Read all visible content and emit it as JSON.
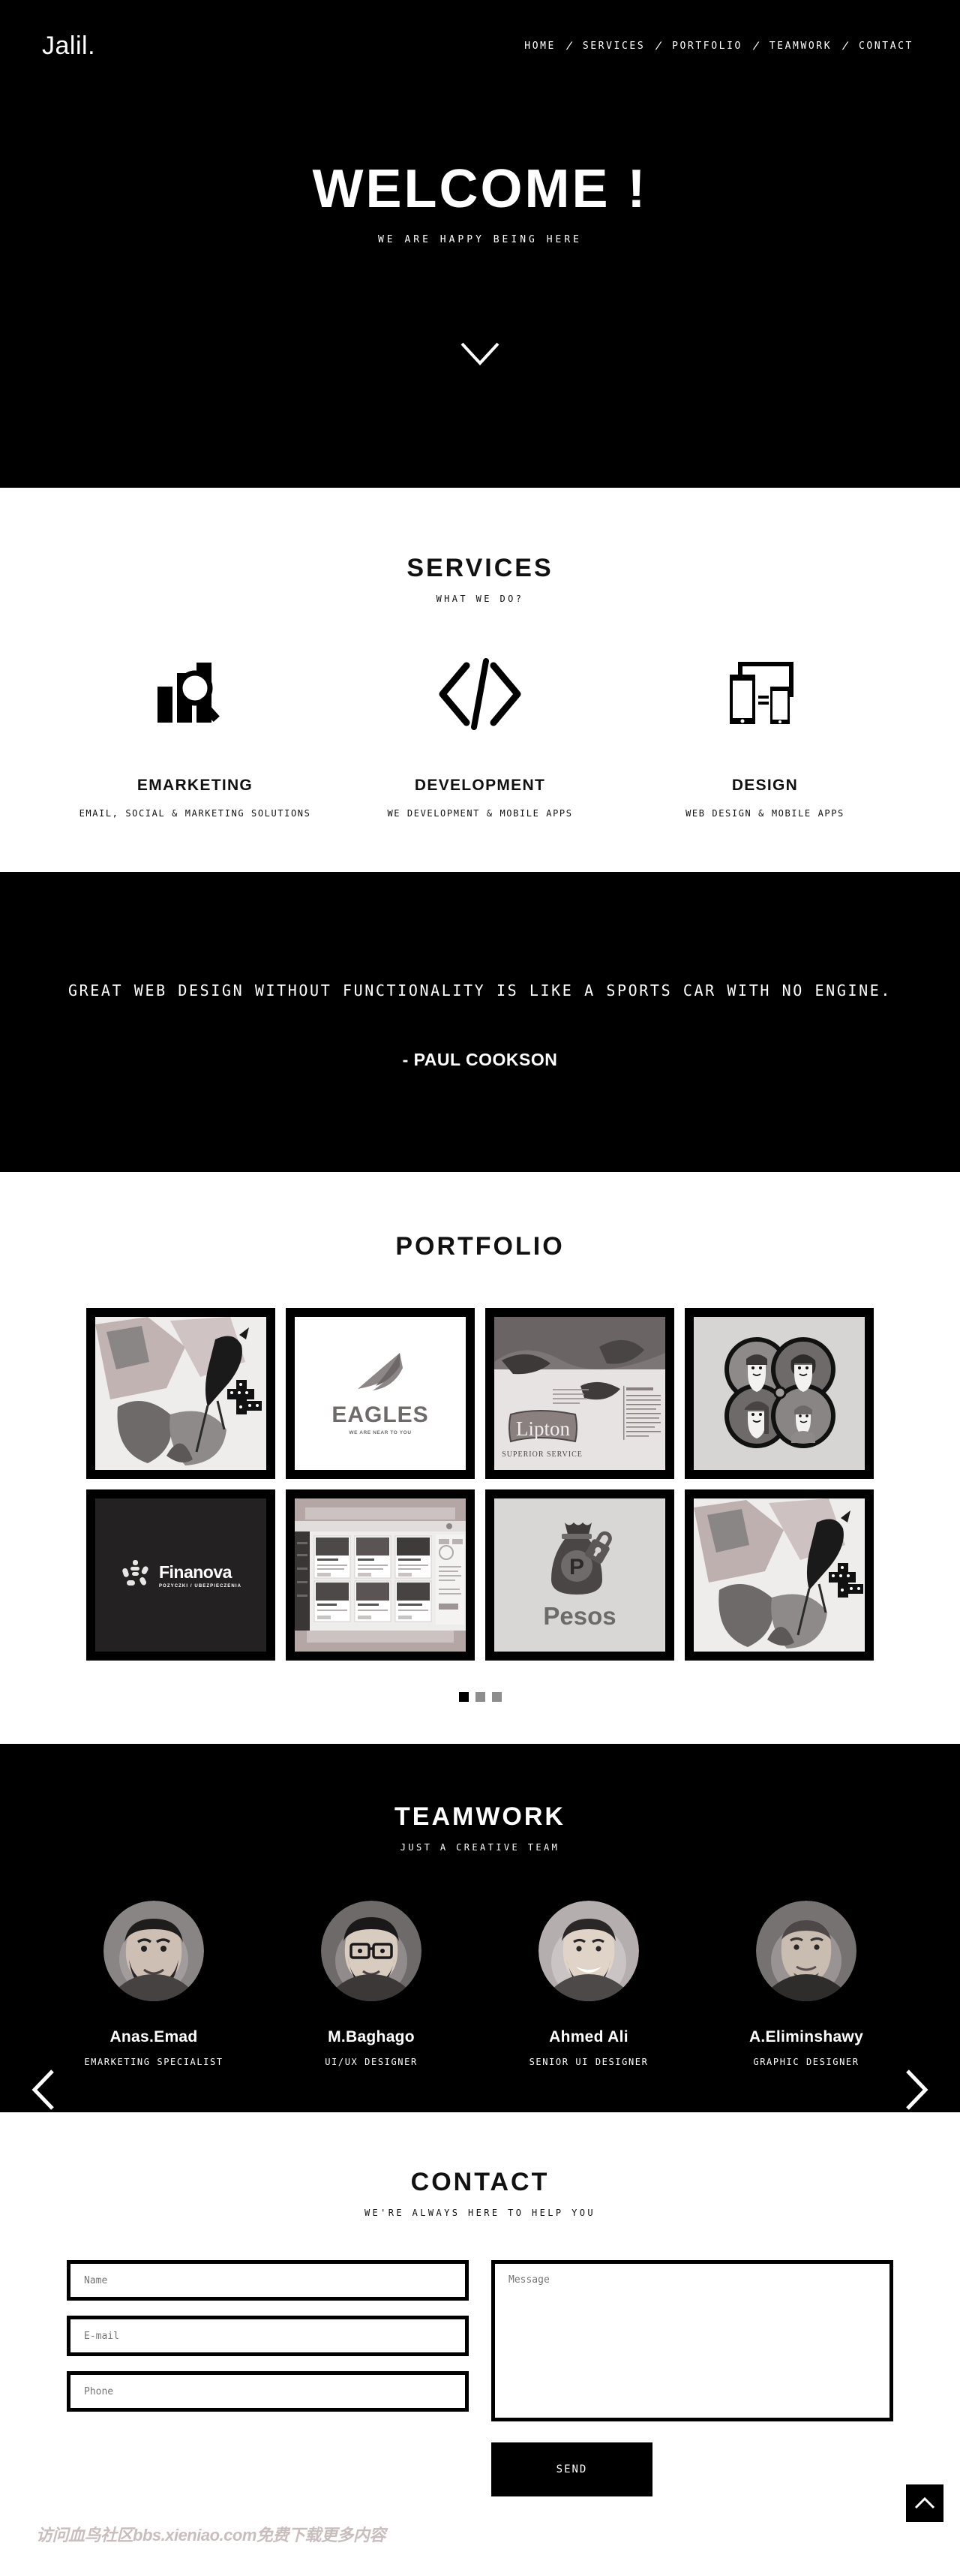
{
  "header": {
    "logo": "Jalil.",
    "nav": [
      {
        "label": "HOME"
      },
      {
        "label": "SERVICES"
      },
      {
        "label": "PORTFOLIO"
      },
      {
        "label": "TEAMWORK"
      },
      {
        "label": "CONTACT"
      }
    ],
    "separator": "/"
  },
  "hero": {
    "title": "WELCOME !",
    "subtitle": "WE ARE HAPPY BEING HERE",
    "scroll_icon": "chevron-down-icon"
  },
  "services": {
    "title": "SERVICES",
    "subtitle": "WHAT WE DO?",
    "items": [
      {
        "icon": "chart-magnifier-icon",
        "name": "EMARKETING",
        "desc": "EMAIL, SOCIAL & MARKETING SOLUTIONS"
      },
      {
        "icon": "code-brackets-icon",
        "name": "DEVELOPMENT",
        "desc": "WE DEVELOPMENT & MOBILE APPS"
      },
      {
        "icon": "responsive-devices-icon",
        "name": "DESIGN",
        "desc": "WEB DESIGN & MOBILE APPS"
      }
    ]
  },
  "quote": {
    "text": "GREAT WEB DESIGN WITHOUT FUNCTIONALITY IS LIKE A SPORTS CAR WITH NO ENGINE.",
    "author": "- PAUL COOKSON"
  },
  "portfolio": {
    "title": "PORTFOLIO",
    "items": [
      {
        "name": "bird-flowers-artwork",
        "caption": ""
      },
      {
        "name": "eagles-logo",
        "caption": "EAGLES",
        "sub_caption": "WE ARE NEAR TO YOU"
      },
      {
        "name": "lipton-ad",
        "caption": "Lipton",
        "sub_caption": "SUPERIOR SERVICE"
      },
      {
        "name": "family-avatars-illustration",
        "caption": ""
      },
      {
        "name": "finanova-logo",
        "caption": "Finanova",
        "sub_caption": "POZYCZKI / UBEZPIECZENIA"
      },
      {
        "name": "website-mockup",
        "caption": ""
      },
      {
        "name": "pesos-money-bag",
        "caption": "Pesos"
      },
      {
        "name": "bird-flowers-artwork-2",
        "caption": ""
      }
    ],
    "pagination": {
      "total": 3,
      "active": 1
    }
  },
  "team": {
    "title": "TEAMWORK",
    "subtitle": "JUST A CREATIVE TEAM",
    "prev_icon": "chevron-left-icon",
    "next_icon": "chevron-right-icon",
    "members": [
      {
        "name": "Anas.Emad",
        "role": "EMARKETING SPECIALIST"
      },
      {
        "name": "M.Baghago",
        "role": "UI/UX DESIGNER"
      },
      {
        "name": "Ahmed Ali",
        "role": "SENIOR UI DESIGNER"
      },
      {
        "name": "A.Eliminshawy",
        "role": "GRAPHIC DESIGNER"
      }
    ]
  },
  "contact": {
    "title": "CONTACT",
    "subtitle": "WE'RE ALWAYS HERE TO HELP YOU",
    "fields": {
      "name_placeholder": "Name",
      "name_value": "",
      "email_placeholder": "E-mail",
      "email_value": "",
      "phone_placeholder": "Phone",
      "phone_value": "",
      "message_placeholder": "Message",
      "message_value": ""
    },
    "send_label": "SEND"
  },
  "footer": {
    "to_top_icon": "chevron-up-icon",
    "watermark": "访问血鸟社区bbs.xieniao.com免费下载更多内容"
  },
  "colors": {
    "background_dark": "#000000",
    "background_light": "#ffffff",
    "text_light": "#ffffff",
    "text_dark": "#111111",
    "placeholder": "#7a7a7a",
    "dot_inactive": "#8d8d8d",
    "watermark": "#c9bebe"
  }
}
